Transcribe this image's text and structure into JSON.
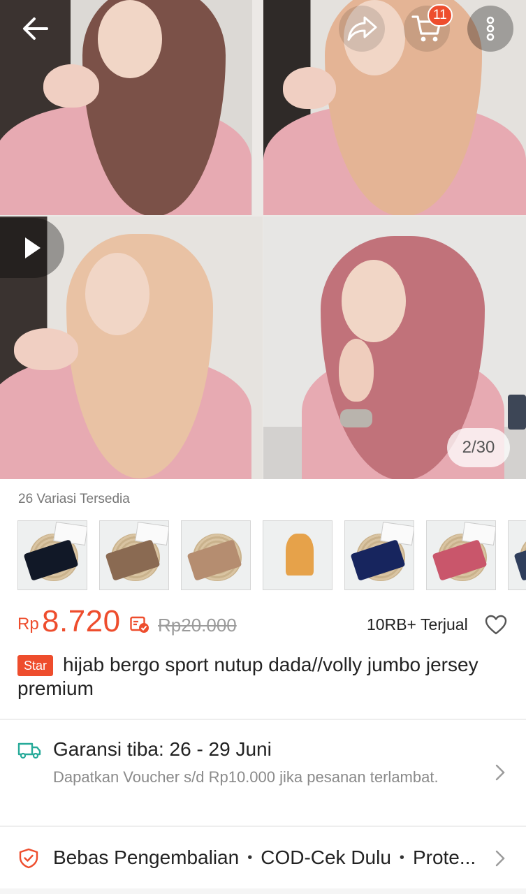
{
  "gallery": {
    "counter": "2/30",
    "cart_count": "11"
  },
  "icons": {
    "back": "arrow-left-icon",
    "share": "share-icon",
    "cart": "cart-icon",
    "more": "more-vertical-icon",
    "play": "play-icon",
    "voucher": "voucher-icon",
    "favorite": "heart-icon",
    "shipping": "truck-icon",
    "returns": "shield-icon",
    "chevron": "chevron-right-icon"
  },
  "variations": {
    "label": "26 Variasi Tersedia",
    "thumb_colors": [
      "#111827",
      "#8a6a52",
      "#b58d70",
      "#e6a24a",
      "#17255e",
      "#c9566b",
      "#2f3e5c"
    ]
  },
  "price": {
    "currency": "Rp",
    "value": "8.720",
    "original": "Rp20.000",
    "sold": "10RB+ Terjual"
  },
  "product": {
    "badge": "Star",
    "title": "hijab bergo sport nutup dada//volly jumbo jersey premium"
  },
  "shipping": {
    "title": "Garansi tiba: 26 - 29 Juni",
    "subtitle": "Dapatkan Voucher s/d Rp10.000 jika pesanan terlambat."
  },
  "guarantees": {
    "items": [
      "Bebas Pengembalian",
      "COD-Cek Dulu",
      "Prote..."
    ]
  },
  "colors": {
    "accent": "#ee4d2d",
    "shipping_green": "#26aa99"
  }
}
